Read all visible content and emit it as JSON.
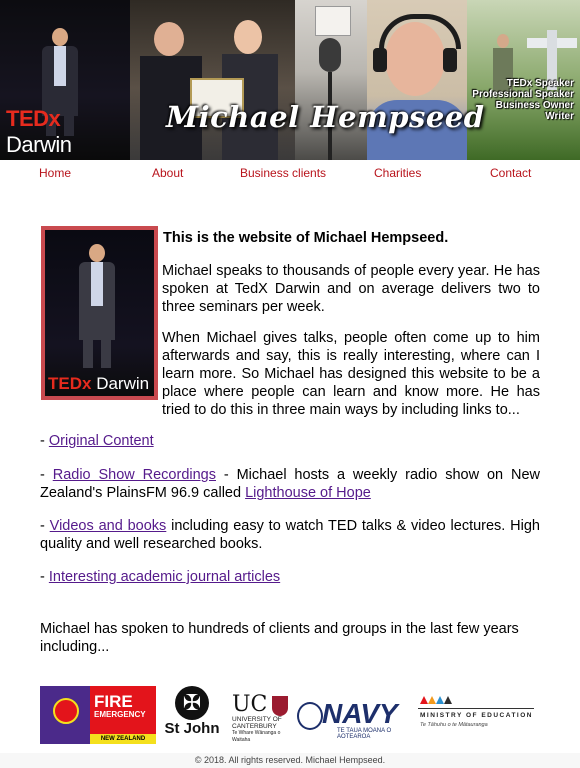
{
  "banner": {
    "title": "Michael Hempseed",
    "ted_logo": "TEDx",
    "ted_city": "Darwin",
    "roles": [
      "TEDx Speaker",
      "Professional Speaker",
      "Business Owner",
      "Writer"
    ]
  },
  "nav": {
    "items": [
      "Home",
      "About",
      "Business clients",
      "Charities",
      "Contact"
    ],
    "color": "#b8141c"
  },
  "intro": {
    "title": "This is the website of Michael Hempseed.",
    "paragraph1": "Michael speaks to thousands of people every year. He has spoken at TedX Darwin and on average delivers two to three seminars per week.",
    "paragraph2": "When Michael gives talks, people often come up to him afterwards and say, this is really interesting, where can I learn more. So Michael has designed this website to be a place where people can learn and know more. He has tried to do this in three main ways by including links to...",
    "photo_ted": "TEDx",
    "photo_city": "Darwin"
  },
  "items": {
    "dash": "- ",
    "original_content": "Original Content",
    "radio_link": "Radio Show Recordings",
    "radio_text": " - Michael hosts a weekly radio show on New Zealand's PlainsFM 96.9 called ",
    "radio_show": "Lighthouse of Hope",
    "videos_link": "Videos and books",
    "videos_text": " including easy to watch TED talks & video lectures. High quality and well researched books.",
    "journal_link": "Interesting academic journal articles"
  },
  "closing": "Michael has spoken to hundreds of clients and groups in the last few years including...",
  "logos": {
    "fire": {
      "line1": "FIRE",
      "line2": "EMERGENCY",
      "strip": "NEW ZEALAND"
    },
    "stjohn": {
      "label": "St John",
      "icon": "maltese-cross-icon"
    },
    "uc": {
      "big": "UC",
      "line1": "UNIVERSITY OF",
      "line2": "CANTERBURY",
      "line3": "Te Whare Wānanga o Waitaha"
    },
    "navy": {
      "word": "NAVY",
      "sub": "TE TAUA MOANA O AOTEAROA"
    },
    "moe": {
      "line1": "MINISTRY OF EDUCATION",
      "line2": "Te Tāhuhu o te Mātauranga"
    }
  },
  "footer": "© 2018. All rights reserved. Michael Hempseed."
}
